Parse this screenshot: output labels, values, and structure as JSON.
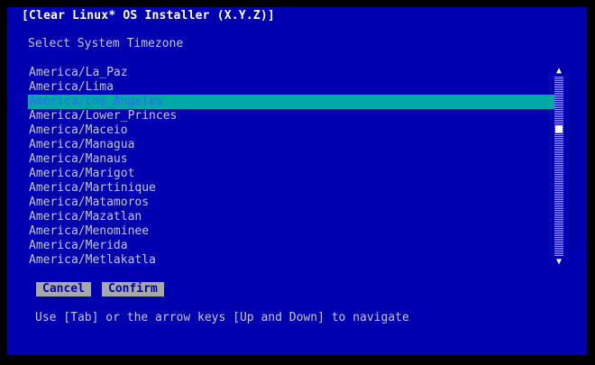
{
  "window": {
    "title": "[Clear Linux* OS Installer (X.Y.Z)]"
  },
  "heading": "Select System Timezone",
  "timezones": [
    {
      "label": "America/La_Paz",
      "selected": false
    },
    {
      "label": "America/Lima",
      "selected": false
    },
    {
      "label": "America/Los_Angeles",
      "selected": true
    },
    {
      "label": "America/Lower_Princes",
      "selected": false
    },
    {
      "label": "America/Maceio",
      "selected": false
    },
    {
      "label": "America/Managua",
      "selected": false
    },
    {
      "label": "America/Manaus",
      "selected": false
    },
    {
      "label": "America/Marigot",
      "selected": false
    },
    {
      "label": "America/Martinique",
      "selected": false
    },
    {
      "label": "America/Matamoros",
      "selected": false
    },
    {
      "label": "America/Mazatlan",
      "selected": false
    },
    {
      "label": "America/Menominee",
      "selected": false
    },
    {
      "label": "America/Merida",
      "selected": false
    },
    {
      "label": "America/Metlakatla",
      "selected": false
    }
  ],
  "scrollbar": {
    "up_icon": "▲",
    "down_icon": "▼"
  },
  "buttons": {
    "cancel_label": "Cancel",
    "confirm_label": "Confirm"
  },
  "hint": "Use [Tab] or the arrow keys [Up and Down] to navigate",
  "colors": {
    "background": "#0000b0",
    "selection": "#00a8a8",
    "button": "#a8a8a8"
  }
}
